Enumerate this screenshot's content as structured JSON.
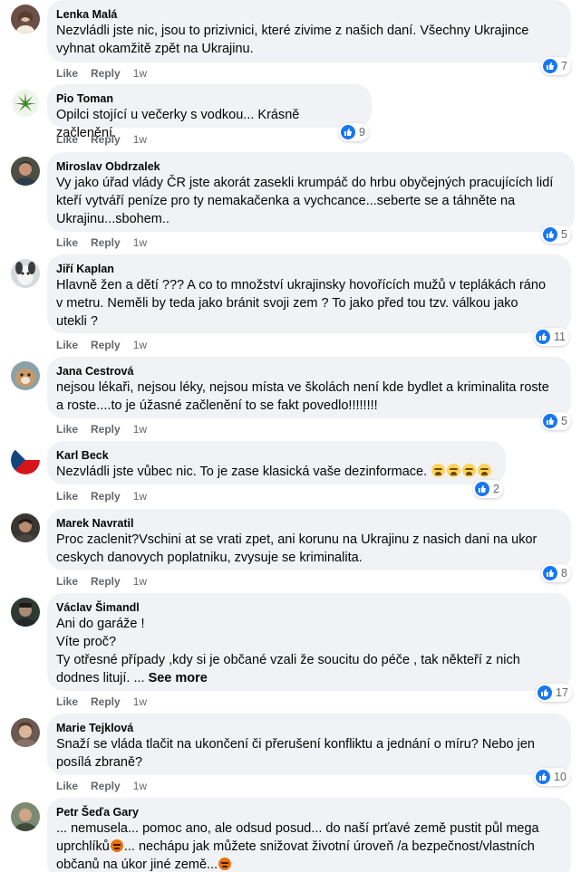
{
  "actions": {
    "like": "Like",
    "reply": "Reply"
  },
  "see_more": "See more",
  "comments": [
    {
      "author": "Lenka Malá",
      "text": "Nezvládli jste nic, jsou to prizivnici, které zivime z našich daní. Všechny Ukrajince\nvyhnat okamžitě zpět na Ukrajinu.",
      "time": "1w",
      "reactions": "7"
    },
    {
      "author": "Pio Toman",
      "text": "Opilci stojící u večerky s vodkou... Krásně začlenění.",
      "time": "1w",
      "reactions": "9"
    },
    {
      "author": "Miroslav Obdrzalek",
      "text": "Vy jako úřad vlády ČR jste akorát zasekli krumpáč do hrbu obyčejných pracujících lidí\nkteří vytváří peníze pro ty nemakačenka a vychcance...seberte se a táhněte na\nUkrajinu...sbohem..",
      "time": "1w",
      "reactions": "5"
    },
    {
      "author": "Jiří Kaplan",
      "text": "Hlavně žen a dětí ??? A co to množství ukrajinsky hovořících mužů v teplákách ráno\nv metru. Neměli by teda jako bránit svoji zem ? To jako před tou tzv. válkou jako\nutekli ?",
      "time": "1w",
      "reactions": "11"
    },
    {
      "author": "Jana Cestrová",
      "text": "nejsou lékaři, nejsou léky, nejsou místa ve školách není kde bydlet a kriminalita roste\na roste....to je úžasné začlenění to se fakt povedlo!!!!!!!!",
      "time": "1w",
      "reactions": "5"
    },
    {
      "author": "Karl Beck",
      "text": "Nezvládli jste vůbec nic. To je zase klasická vaše dezinformace.",
      "time": "1w",
      "reactions": "2"
    },
    {
      "author": "Marek Navratil",
      "text": "Proc zaclenit?Vschini at se vrati zpet, ani korunu na Ukrajinu z nasich dani na ukor\nceskych danovych poplatniku, zvysuje se kriminalita.",
      "time": "1w",
      "reactions": "8"
    },
    {
      "author": "Václav Šimandl",
      "text": "Ani do garáže !\nVíte proč?\nTy otřesné případy ,kdy si je občané vzali že soucitu do péče , tak někteří z nich\ndodnes litují. ...",
      "time": "1w",
      "reactions": "17"
    },
    {
      "author": "Marie Tejklová",
      "text": "Snaží se vláda tlačit na ukončení či přerušení konfliktu a jednání o míru? Nebo jen\nposílá zbraně?",
      "time": "1w",
      "reactions": "10"
    },
    {
      "author": "Petr Šeďa Gary",
      "text_1": "... nemusela... pomoc ano, ale odsud posud... do naší prťavé země pustit půl mega\nuprchlíků",
      "text_2": "... nechápu jak můžete snižovat životní úroveň /a bezpečnost/vlastních\nobčanů na úkor jiné země...",
      "time": "",
      "reactions": ""
    }
  ]
}
